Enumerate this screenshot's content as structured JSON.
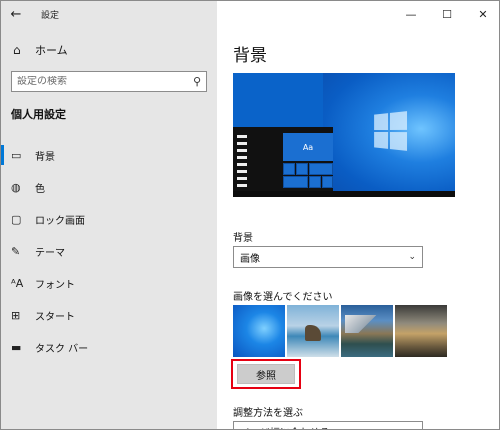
{
  "window": {
    "app_title": "設定",
    "back_icon": "back-arrow-icon",
    "controls": {
      "minimize": "—",
      "maximize": "☐",
      "close": "✕"
    }
  },
  "sidebar": {
    "home": {
      "icon": "home-icon",
      "label": "ホーム"
    },
    "search": {
      "placeholder": "設定の検索",
      "icon": "search-icon"
    },
    "section_title": "個人用設定",
    "items": [
      {
        "icon": "picture-icon",
        "label": "背景",
        "active": true
      },
      {
        "icon": "palette-icon",
        "label": "色",
        "active": false
      },
      {
        "icon": "lock-screen-icon",
        "label": "ロック画面",
        "active": false
      },
      {
        "icon": "theme-brush-icon",
        "label": "テーマ",
        "active": false
      },
      {
        "icon": "font-icon",
        "label": "フォント",
        "active": false
      },
      {
        "icon": "start-icon",
        "label": "スタート",
        "active": false
      },
      {
        "icon": "taskbar-icon",
        "label": "タスク バー",
        "active": false
      }
    ]
  },
  "main": {
    "page_title": "背景",
    "preview_tile_text": "Aa",
    "background_label": "背景",
    "background_value": "画像",
    "choose_picture_label": "画像を選んでください",
    "browse_button": "参照",
    "fit_label": "調整方法を選ぶ",
    "fit_value": "ページ幅に合わせる",
    "accent_color": "#0078d7",
    "highlight_color": "#e60012"
  }
}
